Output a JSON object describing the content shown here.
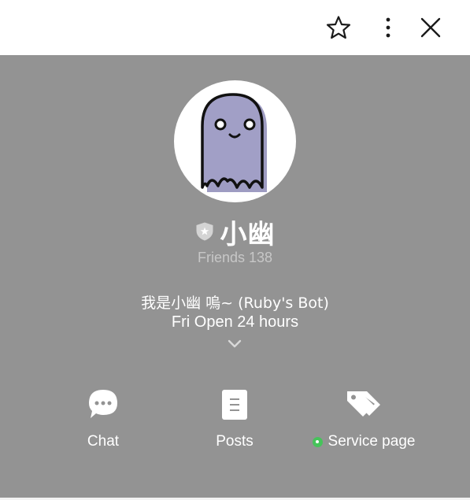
{
  "topbar": {
    "icons": [
      "star-outline-icon",
      "more-vertical-icon",
      "close-icon"
    ]
  },
  "profile": {
    "avatar": "ghost-avatar",
    "badge_icon": "shield-star-icon",
    "name": "小幽",
    "friends": "Friends 138",
    "status_message": "我是小幽 嗚~ (Ruby's Bot)",
    "hours": "Fri Open 24 hours",
    "expand_icon": "chevron-down-icon"
  },
  "actions": [
    {
      "label": "Chat",
      "icon": "chat-bubble-icon"
    },
    {
      "label": "Posts",
      "icon": "posts-icon"
    },
    {
      "label": "Service page",
      "icon": "tags-icon",
      "status_dot_color": "#46c35a"
    }
  ],
  "colors": {
    "header_bg": "#ffffff",
    "profile_bg": "#939393",
    "ghost_fill": "#9e9cc2",
    "online": "#46c35a"
  }
}
